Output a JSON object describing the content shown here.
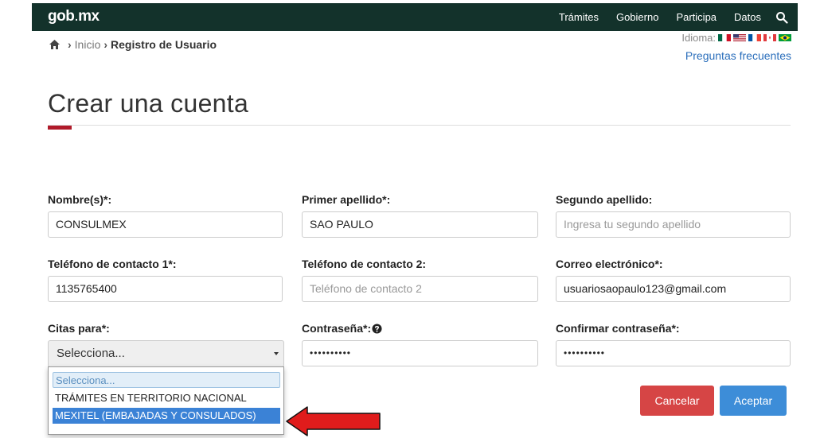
{
  "header": {
    "logo_main": "gob",
    "logo_dot": ".",
    "logo_suffix": "mx",
    "nav": [
      "Trámites",
      "Gobierno",
      "Participa",
      "Datos"
    ]
  },
  "breadcrumb": {
    "home_icon": "home-icon",
    "inicio": "Inicio",
    "current": "Registro de Usuario",
    "separator": "›"
  },
  "lang": {
    "label": "Idioma:"
  },
  "faq_link": "Preguntas frecuentes",
  "page_title": "Crear una cuenta",
  "form": {
    "nombre": {
      "label": "Nombre(s)*:",
      "value": "CONSULMEX"
    },
    "primer_apellido": {
      "label": "Primer apellido*:",
      "value": "SAO PAULO"
    },
    "segundo_apellido": {
      "label": "Segundo apellido:",
      "placeholder": "Ingresa tu segundo apellido"
    },
    "telefono1": {
      "label": "Teléfono de contacto 1*:",
      "value": "1135765400"
    },
    "telefono2": {
      "label": "Teléfono de contacto 2:",
      "placeholder": "Teléfono de contacto 2"
    },
    "correo": {
      "label": "Correo electrónico*:",
      "value": "usuariosaopaulo123@gmail.com"
    },
    "citas": {
      "label": "Citas para*:",
      "selected": "Selecciona...",
      "options": [
        "Selecciona...",
        "TRÁMITES EN TERRITORIO NACIONAL",
        "MEXITEL (EMBAJADAS Y CONSULADOS)"
      ]
    },
    "contrasena": {
      "label": "Contraseña*:",
      "value": "••••••••••"
    },
    "confirmar": {
      "label": "Confirmar contraseña*:",
      "value": "••••••••••"
    }
  },
  "buttons": {
    "cancel": "Cancelar",
    "accept": "Aceptar"
  },
  "colors": {
    "topbar": "#13322b",
    "accent_red": "#b01a2a",
    "cancel": "#d64545",
    "accept": "#3d8dd8",
    "link": "#2a6ebb",
    "arrow": "#e01c1c"
  }
}
